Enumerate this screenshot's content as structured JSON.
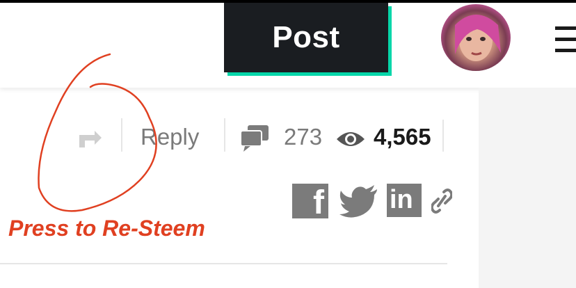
{
  "header": {
    "post_label": "Post",
    "accent_color": "#06d6a9"
  },
  "post_actions": {
    "reply_label": "Reply",
    "comments_count": "273",
    "views_count": "4,565"
  },
  "share": {
    "icons": [
      "facebook-icon",
      "twitter-icon",
      "linkedin-icon",
      "link-icon"
    ]
  },
  "annotation": {
    "label": "Press to Re-Steem",
    "color": "#e04021"
  }
}
